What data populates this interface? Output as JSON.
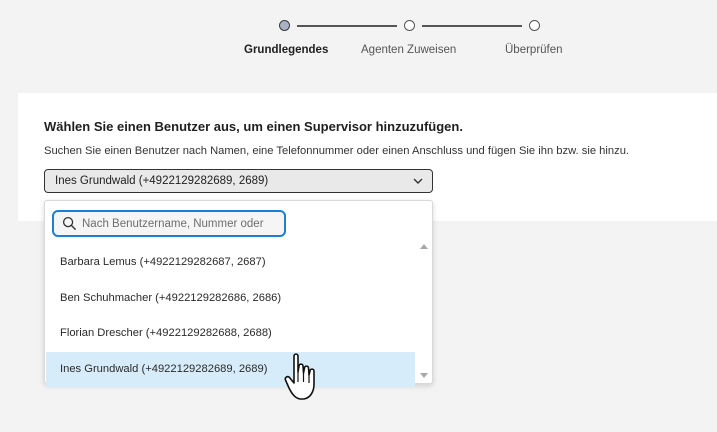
{
  "stepper": {
    "steps": [
      {
        "label": "Grundlegendes",
        "active": true
      },
      {
        "label": "Agenten Zuweisen",
        "active": false
      },
      {
        "label": "Überprüfen",
        "active": false
      }
    ]
  },
  "card": {
    "title": "Wählen Sie einen Benutzer aus, um einen Supervisor hinzuzufügen.",
    "description": "Suchen Sie einen Benutzer nach Namen, eine Telefonnummer oder einen Anschluss und fügen Sie ihn bzw. sie hinzu.",
    "select": {
      "value": "Ines Grundwald (+4922129282689, 2689)",
      "icon": "chevron-down-icon"
    }
  },
  "dropdown": {
    "search": {
      "placeholder": "Nach Benutzername, Nummer oder",
      "value": "",
      "icon": "search-icon"
    },
    "items": [
      {
        "label": "Barbara Lemus (+4922129282687, 2687)",
        "selected": false
      },
      {
        "label": "Ben Schuhmacher (+4922129282686, 2686)",
        "selected": false
      },
      {
        "label": "Florian Drescher (+4922129282688, 2688)",
        "selected": false
      },
      {
        "label": "Ines Grundwald (+4922129282689, 2689)",
        "selected": true
      }
    ]
  },
  "colors": {
    "accent": "#1c7fd6",
    "selected_row": "#d7ecfa",
    "background": "#f3f3f3"
  }
}
